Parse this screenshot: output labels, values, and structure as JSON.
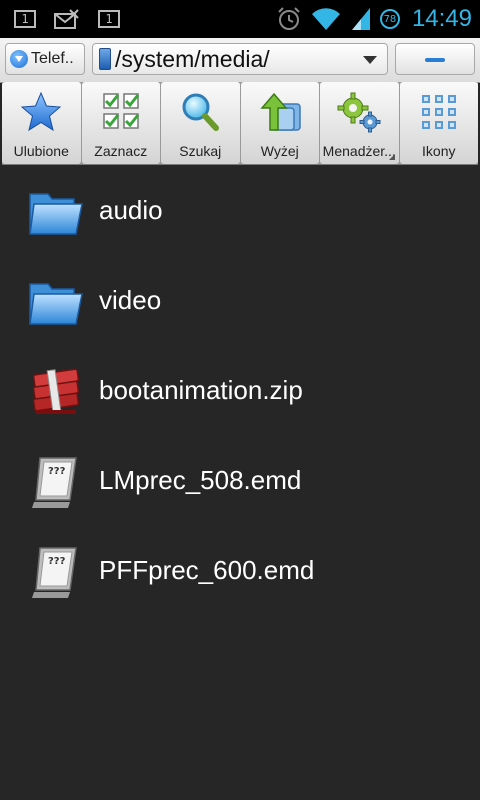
{
  "statusbar": {
    "notif_box_1": "1",
    "notif_box_2": "1",
    "battery_level": "78",
    "time": "14:49",
    "icons": [
      "sim-icon",
      "missed-mail-icon",
      "notification-icon",
      "alarm-icon",
      "wifi-icon",
      "signal-icon",
      "battery-icon"
    ],
    "accent_color": "#33b5e5"
  },
  "pathbar": {
    "storage_label": "Telef..",
    "current_path": "/system/media/"
  },
  "toolbar": {
    "items": [
      {
        "label": "Ulubione",
        "icon": "star-icon"
      },
      {
        "label": "Zaznacz",
        "icon": "checklist-icon"
      },
      {
        "label": "Szukaj",
        "icon": "magnifier-icon"
      },
      {
        "label": "Wyżej",
        "icon": "up-folder-icon"
      },
      {
        "label": "Menadżer...",
        "icon": "gears-icon"
      },
      {
        "label": "Ikony",
        "icon": "grid-icon"
      }
    ]
  },
  "files": [
    {
      "name": "audio",
      "type": "folder"
    },
    {
      "name": "video",
      "type": "folder"
    },
    {
      "name": "bootanimation.zip",
      "type": "archive"
    },
    {
      "name": "LMprec_508.emd",
      "type": "unknown"
    },
    {
      "name": "PFFprec_600.emd",
      "type": "unknown"
    }
  ]
}
